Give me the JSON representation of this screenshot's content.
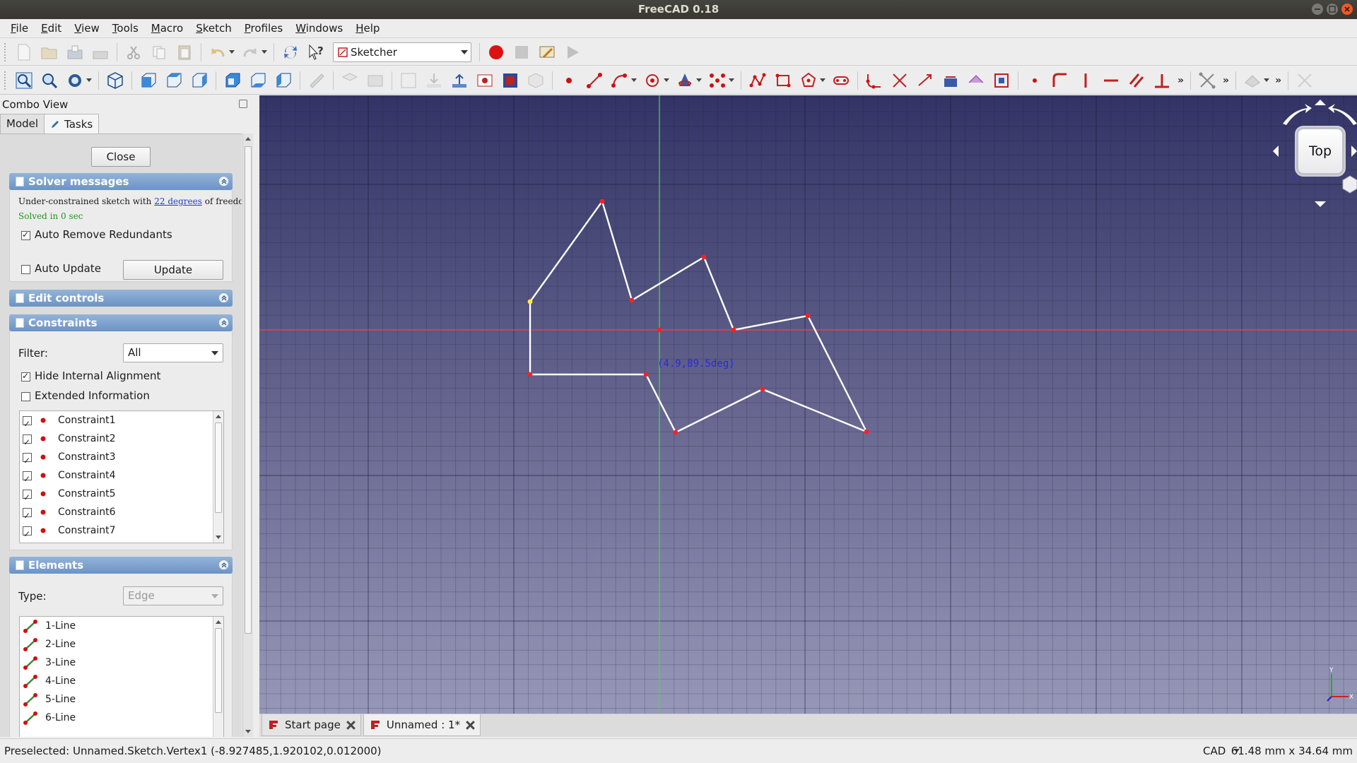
{
  "window": {
    "title": "FreeCAD 0.18"
  },
  "menu": [
    "File",
    "Edit",
    "View",
    "Tools",
    "Macro",
    "Sketch",
    "Profiles",
    "Windows",
    "Help"
  ],
  "toolbar": {
    "workbench": "Sketcher"
  },
  "combo_view": {
    "title": "Combo View",
    "tabs": [
      "Model",
      "Tasks"
    ],
    "close_label": "Close",
    "solver": {
      "header": "Solver messages",
      "message_prefix": "Under-constrained sketch with",
      "dof_link": "22 degrees",
      "message_suffix": "of freedom",
      "solved": "Solved in 0 sec",
      "auto_remove": "Auto Remove Redundants",
      "auto_update": "Auto Update",
      "update_label": "Update"
    },
    "edit_controls": {
      "header": "Edit controls"
    },
    "constraints": {
      "header": "Constraints",
      "filter_label": "Filter:",
      "filter_value": "All",
      "hide_internal": "Hide Internal Alignment",
      "extended_info": "Extended Information",
      "items": [
        "Constraint1",
        "Constraint2",
        "Constraint3",
        "Constraint4",
        "Constraint5",
        "Constraint6",
        "Constraint7"
      ]
    },
    "elements": {
      "header": "Elements",
      "type_label": "Type:",
      "type_value": "Edge",
      "items": [
        "1-Line",
        "2-Line",
        "3-Line",
        "4-Line",
        "5-Line",
        "6-Line"
      ]
    }
  },
  "view3d": {
    "cursor_readout": "(4.9,89.5deg)",
    "navcube_face": "Top",
    "axis_labels": {
      "y": "Y",
      "x": "X"
    }
  },
  "doc_tabs": [
    "Start page",
    "Unnamed : 1*"
  ],
  "status": {
    "message": "Preselected: Unnamed.Sketch.Vertex1 (-8.927485,1.920102,0.012000)",
    "nav_style": "CAD",
    "dimensions": "61.48 mm x 34.64 mm"
  },
  "colors": {
    "panel_header": "#7fa3cf",
    "view_top": "#333366",
    "view_bottom": "#9797b8",
    "sketch_line": "#ffffff",
    "vertex": "#ff2020",
    "x_axis": "#ff4040",
    "y_axis": "#40e040",
    "solved_text": "#1c9a1c",
    "link": "#1a44c8"
  }
}
